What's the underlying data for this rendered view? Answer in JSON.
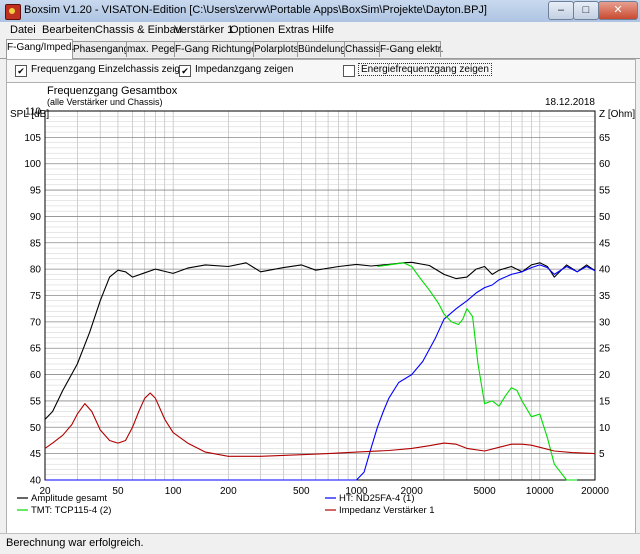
{
  "window": {
    "title": "Boxsim V1.20 - VISATON-Edition [C:\\Users\\zervw\\Portable Apps\\BoxSim\\Projekte\\Dayton.BPJ]",
    "minimize": "–",
    "maximize": "□",
    "close": "✕"
  },
  "menu": [
    "Datei",
    "Bearbeiten",
    "Chassis & Einbau",
    "Verstärker 1",
    "Optionen",
    "Extras",
    "Hilfe"
  ],
  "tabs": [
    "F-Gang/Imped.",
    "Phasengang",
    "max. Pegel",
    "F-Gang Richtungen",
    "Polarplots",
    "Bündelung",
    "Chassis",
    "F-Gang elektr."
  ],
  "options": [
    {
      "label": "Frequenzgang Einzelchassis zeigen",
      "checked": true
    },
    {
      "label": "Impedanzgang zeigen",
      "checked": true
    },
    {
      "label": "Energiefrequenzgang zeigen",
      "checked": false
    }
  ],
  "chart_data": {
    "type": "line",
    "title": "Frequenzgang Gesamtbox",
    "subtitle": "(alle Verstärker und Chassis)",
    "date": "18.12.2018",
    "ylabel_left": "SPL [dB]",
    "ylabel_right": "Z [Ohm]",
    "x_scale": "log",
    "xlim": [
      20,
      20000
    ],
    "ylim_left": [
      40,
      110
    ],
    "ylim_right": [
      0,
      70
    ],
    "x_ticks": [
      20,
      50,
      100,
      200,
      500,
      1000,
      2000,
      5000,
      10000,
      20000
    ],
    "y_ticks_left": [
      40,
      45,
      50,
      55,
      60,
      65,
      70,
      75,
      80,
      85,
      90,
      95,
      100,
      105,
      110
    ],
    "y_ticks_right": [
      5,
      10,
      15,
      20,
      25,
      30,
      35,
      40,
      45,
      50,
      55,
      60,
      65
    ],
    "grid": true,
    "series": [
      {
        "name": "Amplitude gesamt",
        "color": "#000000",
        "axis": "left",
        "x": [
          20,
          22,
          25,
          30,
          35,
          40,
          45,
          50,
          55,
          60,
          70,
          80,
          100,
          120,
          150,
          200,
          250,
          300,
          400,
          500,
          600,
          800,
          1000,
          1200,
          1500,
          1800,
          2000,
          2500,
          3000,
          3500,
          4000,
          4500,
          5000,
          5500,
          6000,
          7000,
          8000,
          9000,
          10000,
          11000,
          12000,
          14000,
          16000,
          18000,
          20000
        ],
        "y": [
          51.5,
          53,
          57,
          62,
          68,
          74,
          78.5,
          79.8,
          79.5,
          78.5,
          79.3,
          80,
          79.2,
          80.2,
          80.8,
          80.5,
          81.2,
          79.5,
          80.3,
          80.8,
          79.8,
          80.5,
          80.9,
          80.6,
          80.9,
          81.2,
          81.3,
          80.7,
          79,
          78.2,
          78.5,
          80,
          80.5,
          79,
          79.8,
          80.5,
          79.5,
          80.8,
          81.2,
          80.5,
          78.5,
          80.8,
          79.5,
          80.8,
          79.7
        ]
      },
      {
        "name": "HT: ND25FA-4 (1)",
        "color": "#0000ff",
        "axis": "left",
        "x": [
          20,
          1000,
          1100,
          1200,
          1300,
          1400,
          1500,
          1700,
          2000,
          2300,
          2700,
          3000,
          3500,
          4000,
          4500,
          5000,
          5500,
          6000,
          7000,
          8000,
          9000,
          10000,
          11000,
          12000,
          14000,
          16000,
          18000,
          20000
        ],
        "y": [
          40,
          40,
          41.5,
          46,
          50,
          53,
          55.5,
          58.5,
          60,
          62.5,
          67,
          70.5,
          72.5,
          74,
          75.5,
          76.5,
          77,
          78,
          79,
          79.5,
          80.3,
          80.8,
          80.3,
          79,
          80.5,
          79.5,
          80.5,
          79.7
        ]
      },
      {
        "name": "TMT: TCP115-4 (2)",
        "color": "#00dd00",
        "axis": "left",
        "x": [
          1300,
          1500,
          1800,
          2000,
          2200,
          2500,
          2800,
          3000,
          3300,
          3600,
          3800,
          4000,
          4300,
          4600,
          5000,
          5500,
          6000,
          6500,
          7000,
          7500,
          8000,
          9000,
          10000,
          11000,
          12000,
          14000,
          16000
        ],
        "y": [
          80.5,
          80.8,
          81.2,
          80.5,
          78.5,
          76,
          73.5,
          71.5,
          70,
          69.5,
          70.5,
          72.5,
          71,
          62,
          54.5,
          55,
          54,
          56,
          57.5,
          57,
          55,
          52,
          52.5,
          48,
          43,
          40,
          40
        ]
      },
      {
        "name": "Impedanz Verstärker 1",
        "color": "#b00000",
        "axis": "right",
        "x": [
          20,
          22,
          25,
          28,
          30,
          33,
          36,
          40,
          45,
          50,
          55,
          60,
          65,
          70,
          75,
          80,
          90,
          100,
          120,
          150,
          200,
          300,
          500,
          700,
          1000,
          1500,
          2000,
          2500,
          3000,
          3500,
          4000,
          5000,
          6000,
          7000,
          8000,
          9000,
          10000,
          12000,
          15000,
          20000
        ],
        "y": [
          6,
          7,
          8.5,
          10.5,
          12.5,
          14.5,
          13,
          9.5,
          7.5,
          7,
          7.5,
          10,
          13,
          15.5,
          16.5,
          15.5,
          11.5,
          9,
          7,
          5.3,
          4.5,
          4.5,
          4.8,
          5,
          5.3,
          5.6,
          6,
          6.5,
          7,
          6.8,
          6,
          5.5,
          6.2,
          6.8,
          6.8,
          6.6,
          6.2,
          5.5,
          5.2,
          5
        ]
      }
    ]
  },
  "status": "Berechnung war erfolgreich."
}
